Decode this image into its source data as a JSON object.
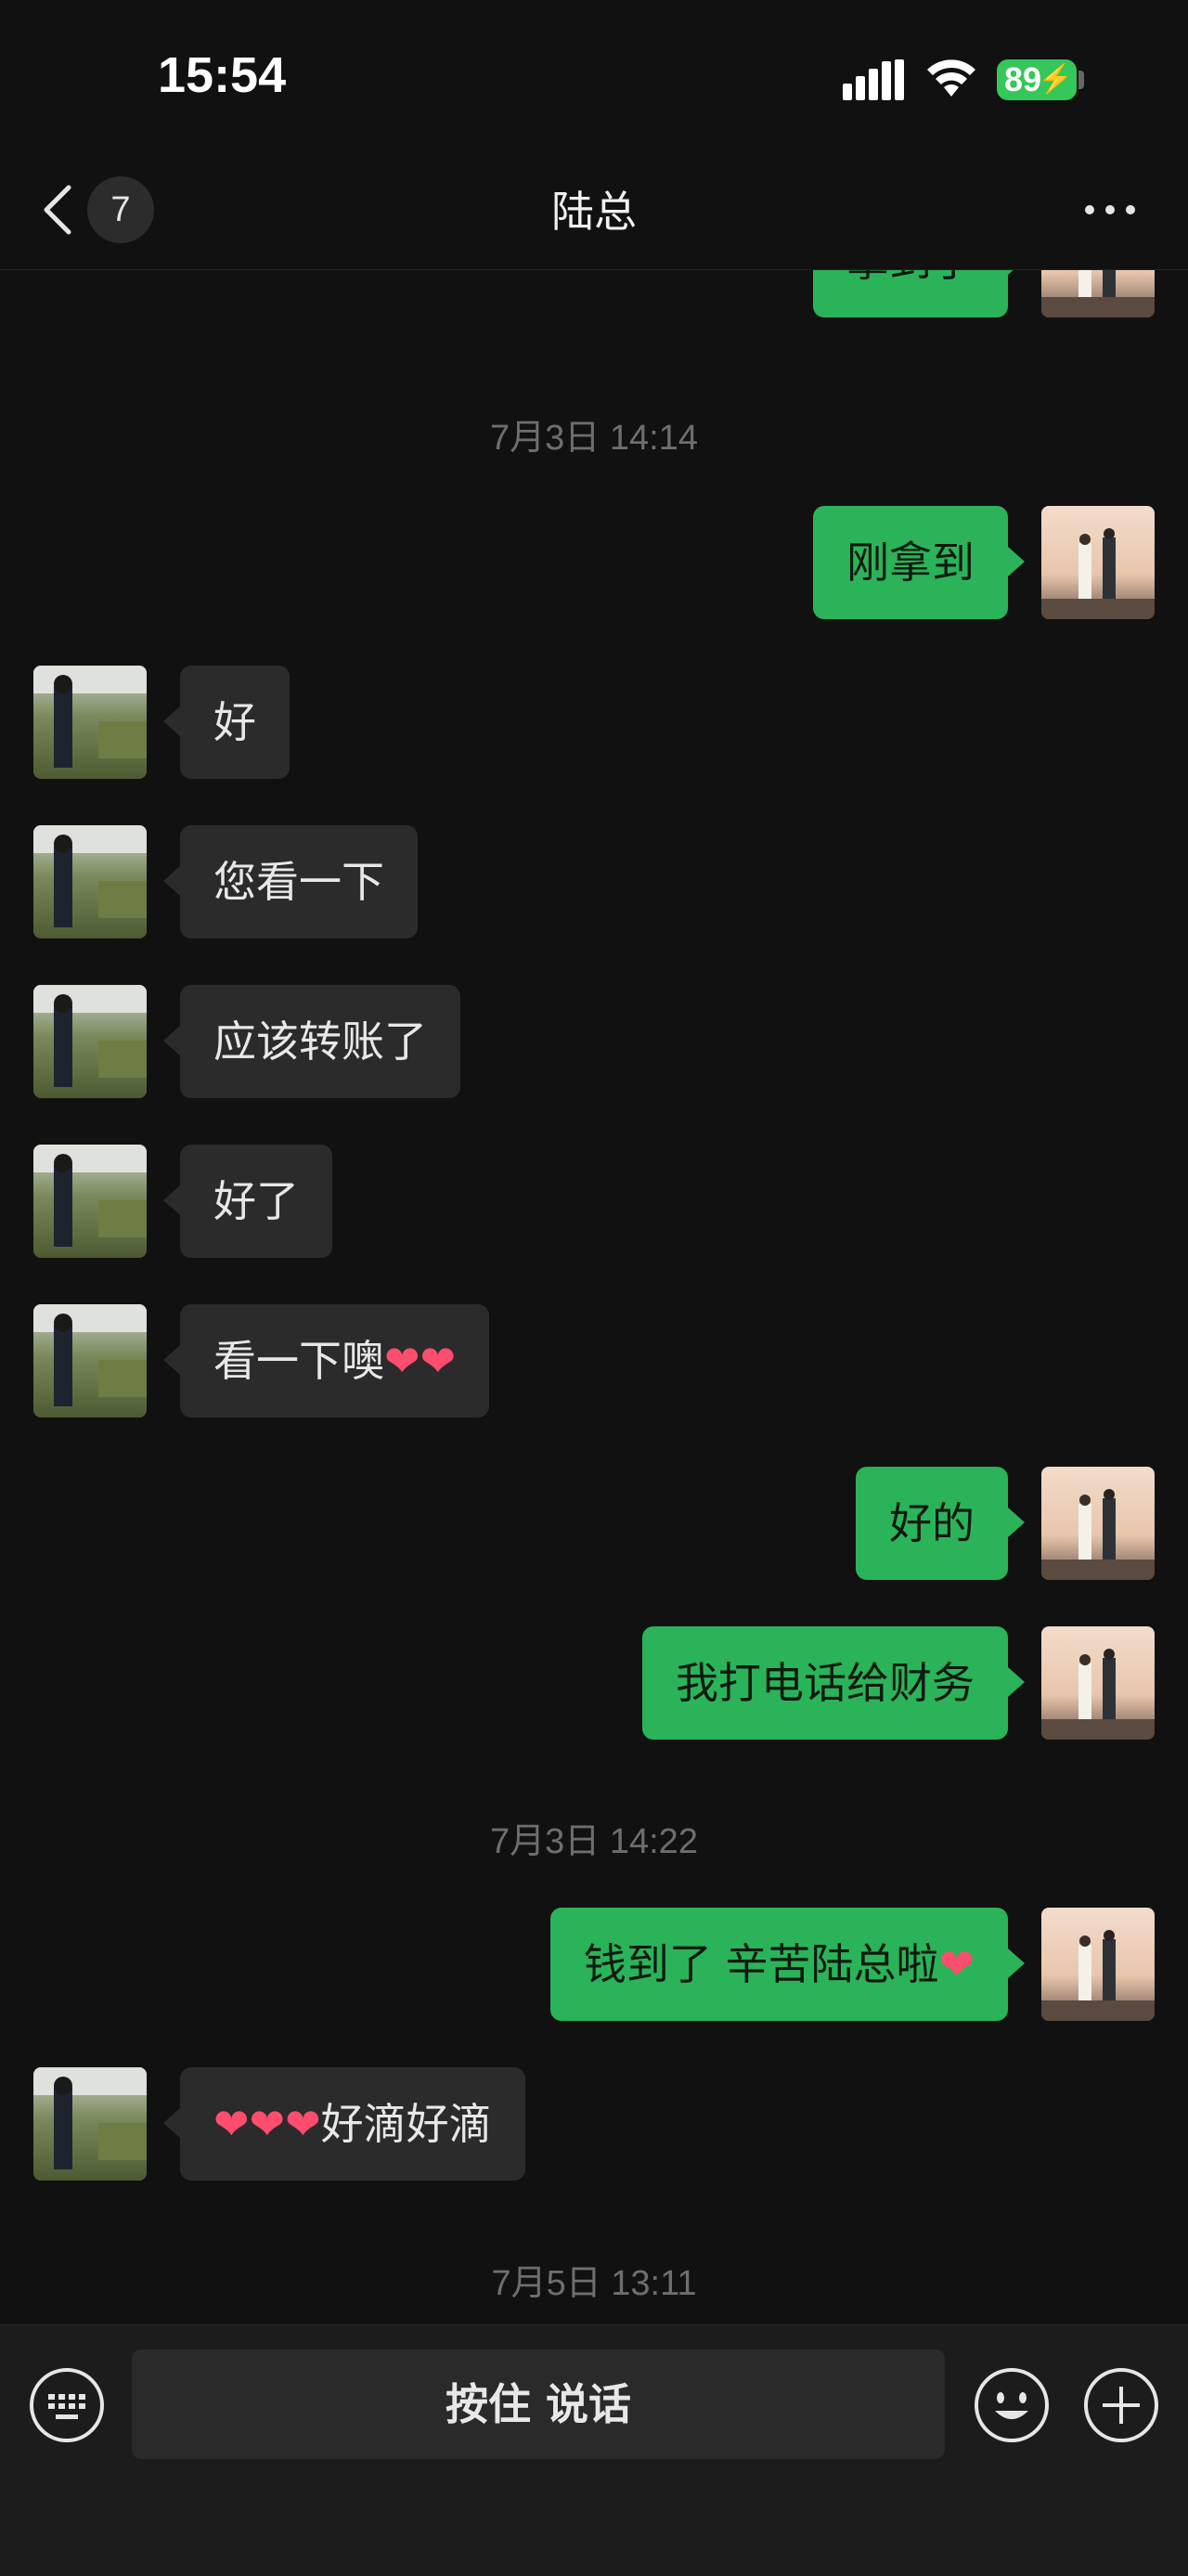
{
  "status_bar": {
    "time": "15:54",
    "battery": "89"
  },
  "nav": {
    "unread_count": "7",
    "title": "陆总"
  },
  "messages": [
    {
      "type": "self",
      "text": "拿到了"
    },
    {
      "type": "time",
      "text": "7月3日 14:14"
    },
    {
      "type": "self",
      "text": "刚拿到"
    },
    {
      "type": "other",
      "text": "好"
    },
    {
      "type": "other",
      "text": "您看一下"
    },
    {
      "type": "other",
      "text": "应该转账了"
    },
    {
      "type": "other",
      "text": "好了"
    },
    {
      "type": "other",
      "text": "看一下噢",
      "hearts": "❤❤"
    },
    {
      "type": "self",
      "text": "好的"
    },
    {
      "type": "self",
      "text": "我打电话给财务"
    },
    {
      "type": "time",
      "text": "7月3日 14:22"
    },
    {
      "type": "self",
      "text": "钱到了 辛苦陆总啦",
      "hearts": "❤"
    },
    {
      "type": "other",
      "text": "好滴好滴",
      "hearts_before": "❤❤❤"
    },
    {
      "type": "time",
      "text": "7月5日 13:11"
    }
  ],
  "input_bar": {
    "hold_to_talk_label": "按住 说话"
  },
  "colors": {
    "self_bubble": "#2bb35a",
    "other_bubble": "#2b2b2b",
    "background": "#111111"
  }
}
